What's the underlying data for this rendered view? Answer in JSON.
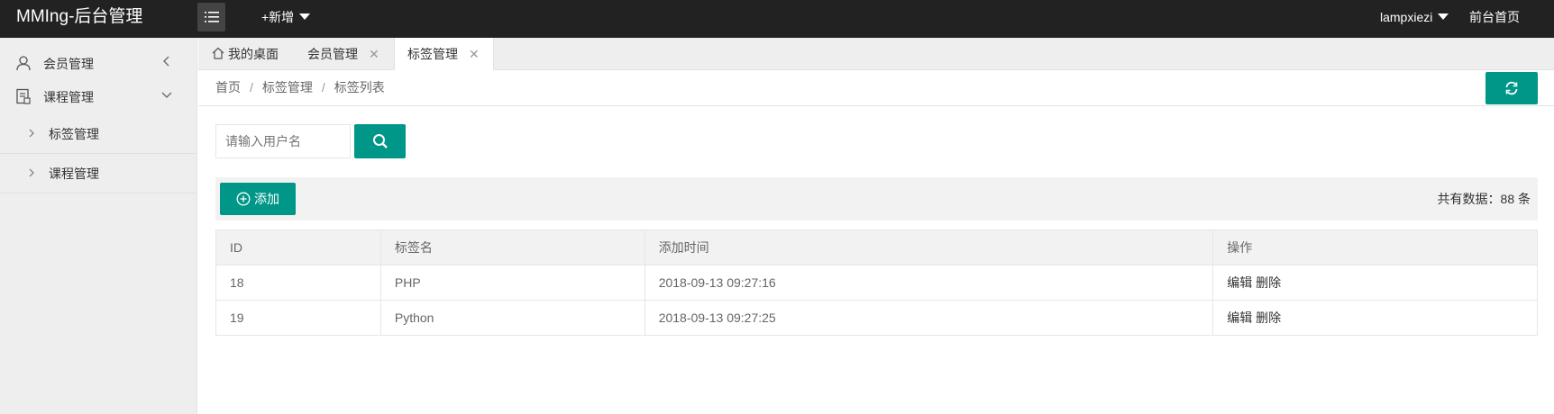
{
  "header": {
    "logo": "MMIng-后台管理",
    "new_label": "+新增",
    "user_label": "lampxiezi",
    "front_label": "前台首页"
  },
  "sidebar": {
    "items": [
      {
        "label": "会员管理",
        "icon": "user-icon",
        "arrow": "chevron-left-icon"
      },
      {
        "label": "课程管理",
        "icon": "course-icon",
        "arrow": "chevron-down-icon"
      }
    ],
    "sub_items": [
      {
        "label": "标签管理"
      },
      {
        "label": "课程管理"
      }
    ]
  },
  "tabs": [
    {
      "label": "我的桌面",
      "closable": false
    },
    {
      "label": "会员管理",
      "closable": true
    },
    {
      "label": "标签管理",
      "closable": true,
      "active": true
    }
  ],
  "tab_close_glyph": "✕",
  "breadcrumb": {
    "items": [
      "首页",
      "标签管理",
      "标签列表"
    ],
    "separator": "/"
  },
  "search": {
    "placeholder": "请输入用户名",
    "value": ""
  },
  "toolbar": {
    "add_label": "添加",
    "total_text": "共有数据：88 条"
  },
  "table": {
    "columns": [
      "ID",
      "标签名",
      "添加时间",
      "操作"
    ],
    "rows": [
      {
        "id": "18",
        "name": "PHP",
        "time": "2018-09-13 09:27:16",
        "edit": "编辑",
        "delete": "删除"
      },
      {
        "id": "19",
        "name": "Python",
        "time": "2018-09-13 09:27:25",
        "edit": "编辑",
        "delete": "删除"
      }
    ]
  },
  "colors": {
    "header_bg": "#222222",
    "accent": "#009688",
    "sidebar_bg": "#eeeeee"
  }
}
